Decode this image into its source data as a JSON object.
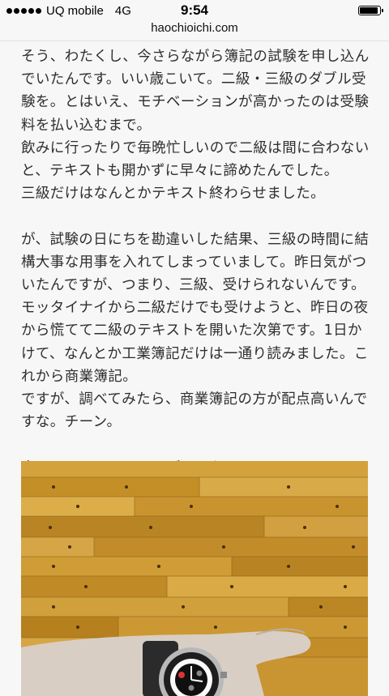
{
  "status_bar": {
    "carrier": "UQ mobile",
    "network": "4G",
    "time": "9:54",
    "battery_level": 0.85,
    "signal_bars": 5
  },
  "url_bar": {
    "domain": "haochioichi.com"
  },
  "article": {
    "paragraphs": [
      "そう、わたくし、今さらながら簿記の試験を申し込んでいたんです。いい歳こいて。二級・三級のダブル受験を。とはいえ、モチベーションが高かったのは受験料を払い込むまで。",
      "飲みに行ったりで毎晩忙しいので二級は間に合わないと、テキストも開かずに早々に諦めたんでした。",
      "三級だけはなんとかテキスト終わらせました。",
      "",
      "が、試験の日にちを勘違いした結果、三級の時間に結構大事な用事を入れてしまっていまして。昨日気がついたんですが、つまり、三級、受けられないんです。",
      "モッタイナイから二級だけでも受けようと、昨日の夜から慌てて二級のテキストを開いた次第です。1日かけて、なんとか工業簿記だけは一通り読みました。これから商業簿記。",
      "ですが、調べてみたら、商業簿記の方が配点高いんですな。チーン。",
      "",
      "今日は、チュチマのメディック。"
    ]
  },
  "photo": {
    "subject": "wristwatch-on-wooden-floor",
    "colors": {
      "wood_light": "#d4a640",
      "wood_mid": "#c08d28",
      "wood_dark": "#a8761c",
      "skin": "#d9cfc6",
      "strap": "#2a2a2a"
    }
  }
}
